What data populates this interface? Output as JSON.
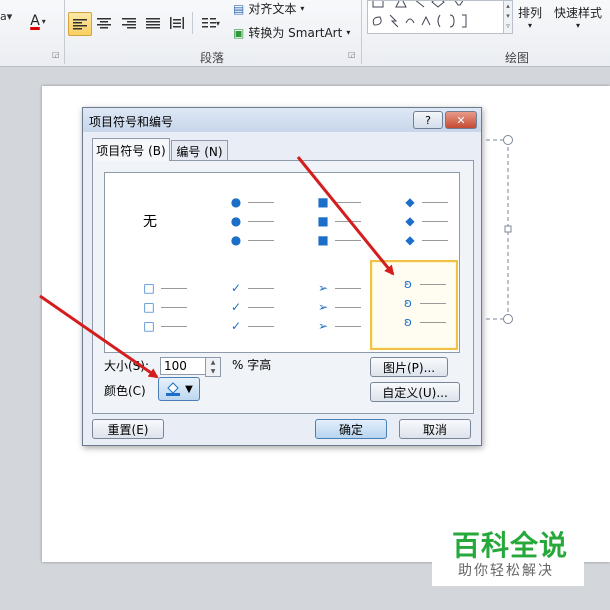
{
  "ribbon": {
    "font_group": {
      "font_color_label": "A"
    },
    "paragraph_group": {
      "align_text_label": "对齐文本",
      "convert_smartart_label": "转换为 SmartArt",
      "group_label": "段落"
    },
    "drawing_group": {
      "arrange_label": "排列",
      "quick_styles_label": "快速样式",
      "group_label": "绘图"
    }
  },
  "dialog": {
    "title": "项目符号和编号",
    "help_label": "?",
    "close_label": "✕",
    "tabs": [
      {
        "label": "项目符号 (B)"
      },
      {
        "label": "编号 (N)"
      }
    ],
    "gallery": {
      "none_label": "无",
      "bullet_styles": [
        {
          "name": "filled-round",
          "glyph": "●",
          "color": "#1c6fc8"
        },
        {
          "name": "filled-square",
          "glyph": "■",
          "color": "#1c6fc8"
        },
        {
          "name": "diamond",
          "glyph": "◆",
          "color": "#1c6fc8"
        },
        {
          "name": "hollow-square",
          "glyph": "□",
          "color": "#1c6fc8"
        },
        {
          "name": "checkmark",
          "glyph": "✓",
          "color": "#1c6fc8"
        },
        {
          "name": "arrowhead",
          "glyph": "➢",
          "color": "#1c6fc8"
        },
        {
          "name": "scroll",
          "glyph": "ʚ",
          "color": "#1c6fc8"
        }
      ],
      "selected_style": "scroll"
    },
    "size_label": "大小(S):",
    "size_value": "100",
    "size_unit_label": "% 字高",
    "color_label": "颜色(C)",
    "picture_button_label": "图片(P)...",
    "customize_button_label": "自定义(U)...",
    "reset_button_label": "重置(E)",
    "ok_button_label": "确定",
    "cancel_button_label": "取消"
  },
  "watermark": {
    "title": "百科全说",
    "subtitle": "助你轻松解决"
  },
  "colors": {
    "bullet_blue": "#1c6fc8",
    "selection_gold": "#f0c047",
    "arrow_red": "#d41d1d",
    "watermark_green": "#27a83a"
  }
}
